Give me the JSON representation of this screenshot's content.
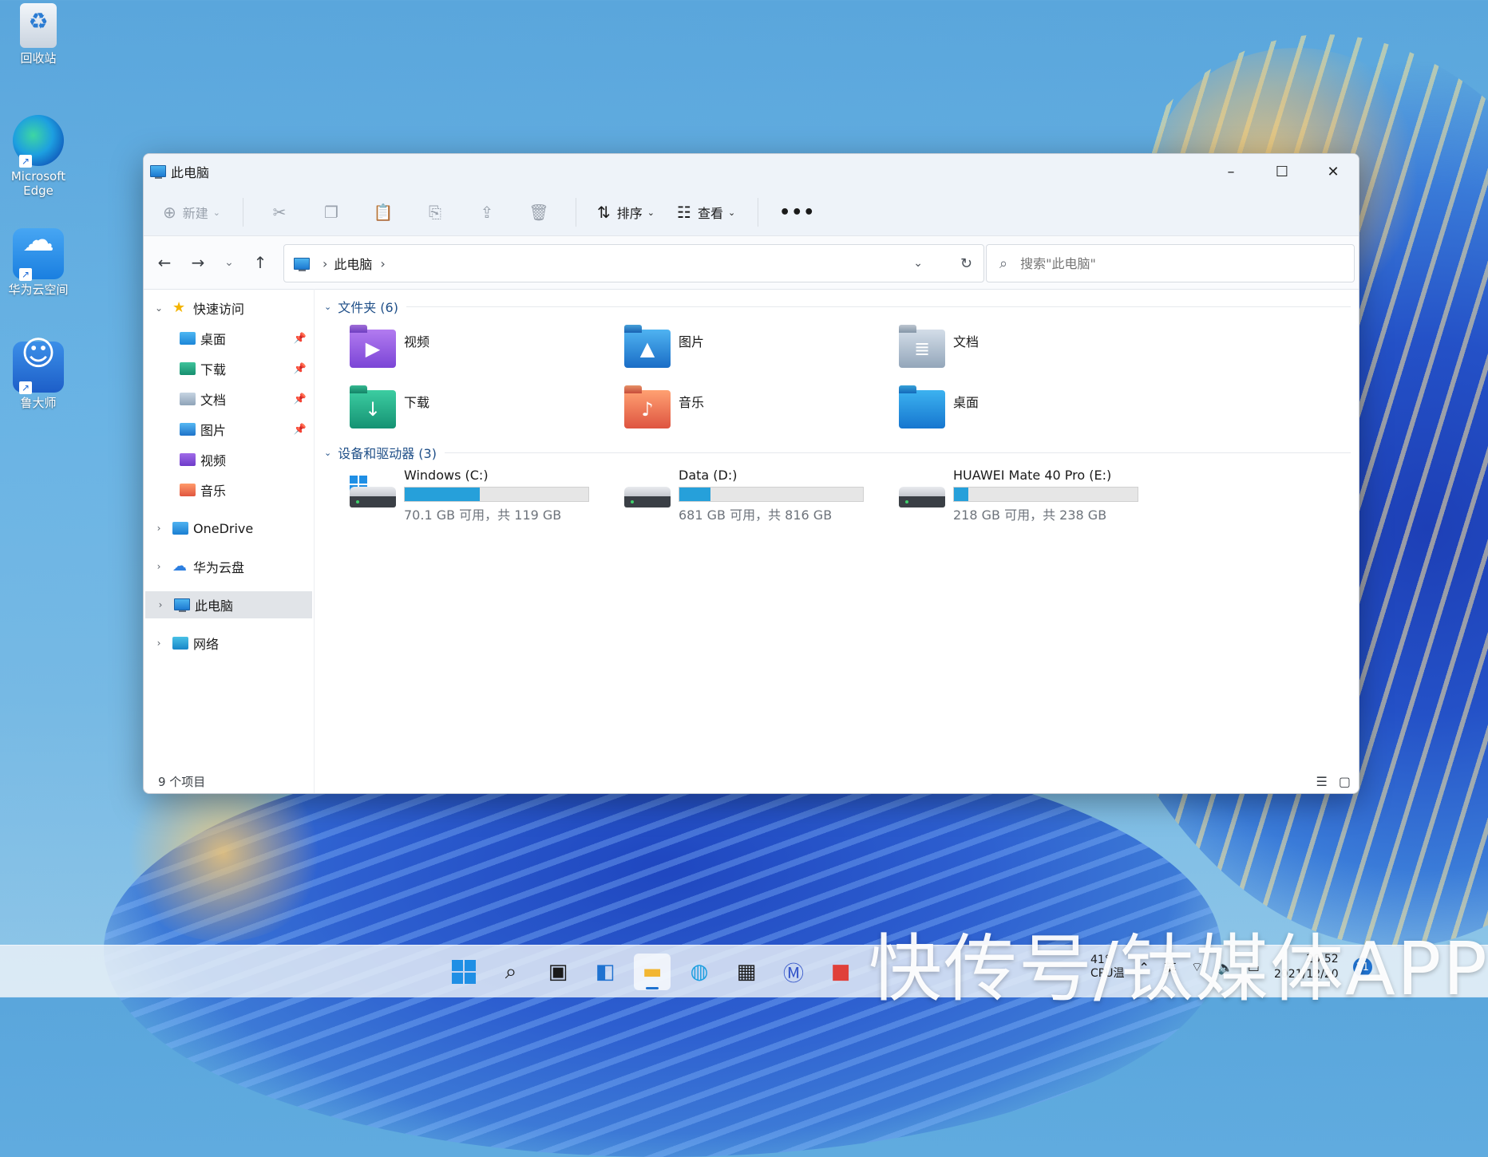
{
  "desktop": {
    "icons": [
      {
        "label": "回收站",
        "icon": "recycle-bin-icon"
      },
      {
        "label": "Microsoft Edge",
        "icon": "edge-icon"
      },
      {
        "label": "华为云空间",
        "icon": "huawei-cloud-icon"
      },
      {
        "label": "鲁大师",
        "icon": "ludashi-icon"
      }
    ]
  },
  "window": {
    "title": "此电脑",
    "controls": {
      "minimize": "–",
      "maximize": "☐",
      "close": "✕"
    }
  },
  "commandbar": {
    "new_label": "新建",
    "sort_label": "排序",
    "view_label": "查看",
    "more_label": "•••"
  },
  "address": {
    "crumb": "此电脑",
    "search_placeholder": "搜索\"此电脑\""
  },
  "nav": {
    "quick_access": "快速访问",
    "items": [
      {
        "label": "桌面",
        "pinned": true
      },
      {
        "label": "下载",
        "pinned": true
      },
      {
        "label": "文档",
        "pinned": true
      },
      {
        "label": "图片",
        "pinned": true
      },
      {
        "label": "视频",
        "pinned": false
      },
      {
        "label": "音乐",
        "pinned": false
      }
    ],
    "onedrive": "OneDrive",
    "huawei_cloud": "华为云盘",
    "this_pc": "此电脑",
    "network": "网络"
  },
  "content": {
    "folders_header": "文件夹 (6)",
    "folders": [
      "视频",
      "图片",
      "文档",
      "下载",
      "音乐",
      "桌面"
    ],
    "drives_header": "设备和驱动器 (3)",
    "drives": [
      {
        "name": "Windows (C:)",
        "free_text": "70.1 GB 可用，共 119 GB",
        "used_fraction": 0.41
      },
      {
        "name": "Data (D:)",
        "free_text": "681 GB 可用，共 816 GB",
        "used_fraction": 0.17
      },
      {
        "name": "HUAWEI Mate 40 Pro (E:)",
        "free_text": "218 GB 可用，共 238 GB",
        "used_fraction": 0.08
      }
    ]
  },
  "status": {
    "count": "9 个项目"
  },
  "taskbar": {
    "temp_line1": "41°",
    "temp_line2": "CPU温",
    "ime": "英",
    "time": "20:52",
    "date": "2021/12/20",
    "notifications": "11"
  },
  "watermark": "快传号/钛媒体APP",
  "colors": {
    "accent": "#26a0da",
    "selection": "#e1e4e8"
  }
}
